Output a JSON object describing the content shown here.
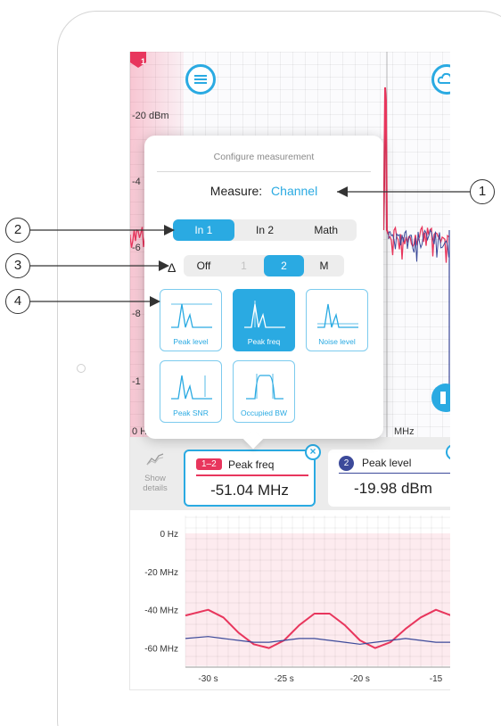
{
  "spectrum": {
    "label_top": "-20 dBm",
    "label_r1": "-4",
    "label_r2": "-6",
    "label_r3": "-8",
    "label_r4": "-1",
    "label_bottom_left": "0 H",
    "label_bottom_right": "MHz",
    "marker": "1"
  },
  "popover": {
    "title": "Configure measurement",
    "measure_label": "Measure:",
    "measure_value": "Channel",
    "input_segments": [
      "In 1",
      "In 2",
      "Math"
    ],
    "input_selected": "In 1",
    "delta_symbol": "Δ",
    "delta_segments": [
      "Off",
      "1",
      "2",
      "M"
    ],
    "delta_selected": "2",
    "tiles": [
      {
        "label": "Peak level"
      },
      {
        "label": "Peak freq"
      },
      {
        "label": "Noise level"
      },
      {
        "label": "Peak SNR"
      },
      {
        "label": "Occupied BW"
      }
    ],
    "selected_tile": "Peak freq"
  },
  "strip": {
    "show_details_line1": "Show",
    "show_details_line2": "details",
    "card1": {
      "badge": "1–2",
      "title": "Peak freq",
      "value": "-51.04 MHz",
      "color": "#e8365d"
    },
    "card2": {
      "badge": "2",
      "title": "Peak level",
      "value": "-19.98 dBm",
      "color": "#3c4a9a"
    },
    "close_glyph": "×"
  },
  "chart_data": {
    "type": "line",
    "y_ticks": [
      "0 Hz",
      "-20 MHz",
      "-40 MHz",
      "-60 MHz"
    ],
    "x_ticks": [
      "-30 s",
      "-25 s",
      "-20 s",
      "-15"
    ],
    "ylim": [
      -70,
      0
    ],
    "xlim": [
      -31.5,
      -14
    ],
    "series": [
      {
        "color": "#e8365d",
        "x": [
          -31.5,
          -30,
          -29,
          -28,
          -27,
          -26,
          -25,
          -24,
          -23,
          -22,
          -21,
          -20,
          -19,
          -18,
          -17,
          -16,
          -15,
          -14
        ],
        "y": [
          -43,
          -40,
          -44,
          -52,
          -58,
          -60,
          -56,
          -48,
          -42,
          -42,
          -48,
          -56,
          -60,
          -57,
          -50,
          -44,
          -40,
          -43
        ]
      },
      {
        "color": "#3c4a9a",
        "x": [
          -31.5,
          -30,
          -29,
          -28,
          -27,
          -26,
          -25,
          -24,
          -23,
          -22,
          -21,
          -20,
          -19,
          -18,
          -17,
          -16,
          -15,
          -14
        ],
        "y": [
          -55,
          -54,
          -55,
          -56,
          -57,
          -57,
          -56,
          -55,
          -55,
          -56,
          -57,
          -58,
          -57,
          -56,
          -55,
          -56,
          -57,
          -57
        ]
      }
    ]
  },
  "callouts": [
    "1",
    "2",
    "3",
    "4"
  ]
}
